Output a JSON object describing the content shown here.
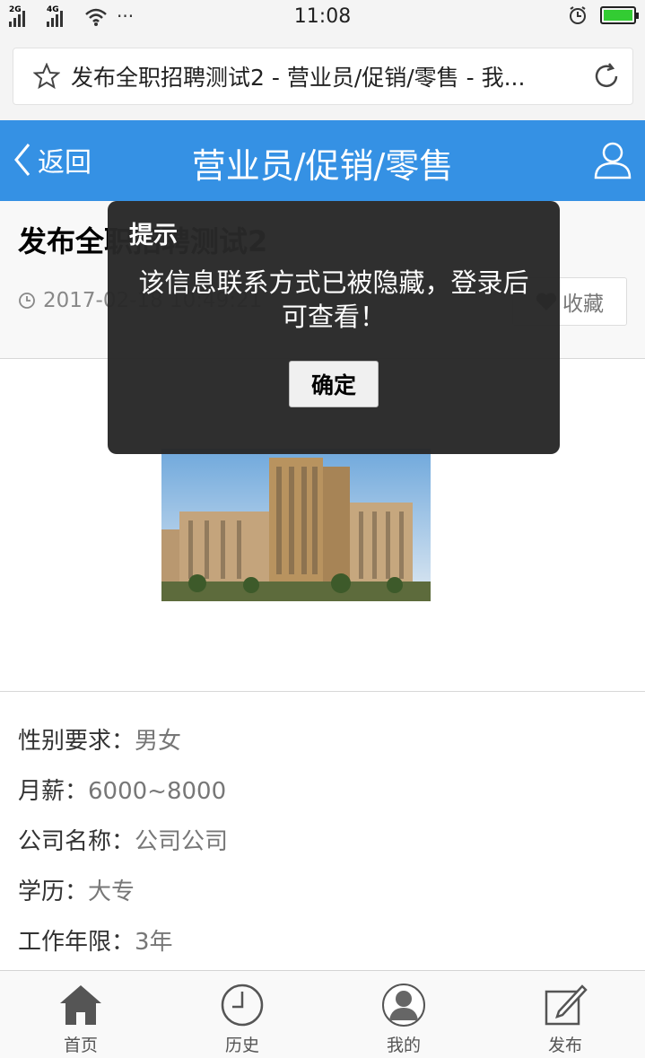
{
  "status_bar": {
    "signal1_label": "2G",
    "signal2_label": "4G",
    "more": "···",
    "time": "11:08"
  },
  "browser": {
    "page_title": "发布全职招聘测试2 - 营业员/促销/零售 - 我..."
  },
  "header": {
    "back_label": "返回",
    "title": "营业员/促销/零售",
    "accent_color": "#3591e4"
  },
  "post": {
    "title": "发布全职招聘测试2",
    "datetime": "2017-02-18 10:49:21",
    "favorite_label": "收藏"
  },
  "details": [
    {
      "label": "性别要求：",
      "value": "男女"
    },
    {
      "label": " 月薪：",
      "value": "6000~8000"
    },
    {
      "label": "公司名称：",
      "value": "公司公司"
    },
    {
      "label": " 学历：",
      "value": "大专"
    },
    {
      "label": "工作年限：",
      "value": "3年"
    }
  ],
  "tabs": [
    {
      "label": "首页",
      "icon": "home-icon"
    },
    {
      "label": "历史",
      "icon": "clock-icon"
    },
    {
      "label": "我的",
      "icon": "profile-icon"
    },
    {
      "label": "发布",
      "icon": "edit-icon"
    }
  ],
  "dialog": {
    "title": "提示",
    "message": "该信息联系方式已被隐藏，登录后可查看！",
    "confirm_label": "确定"
  }
}
